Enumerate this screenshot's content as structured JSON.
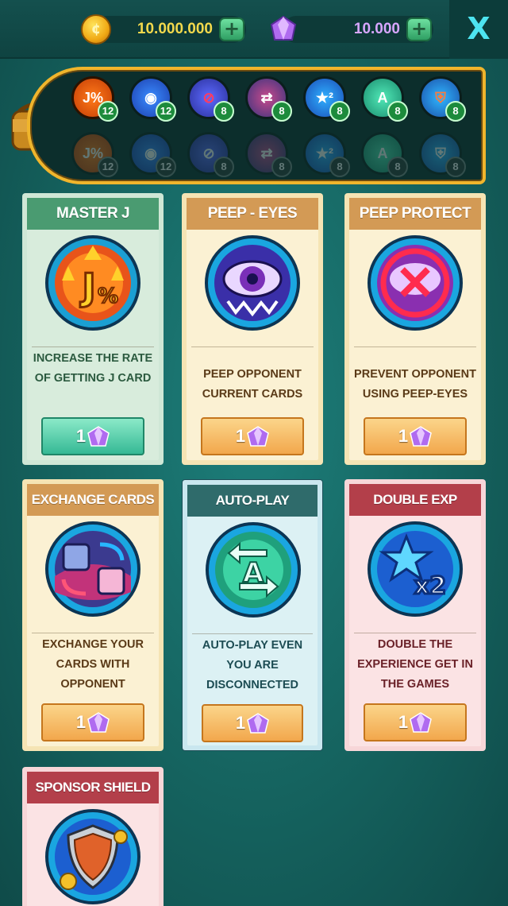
{
  "header": {
    "coins": "10.000.000",
    "gems": "10.000",
    "coin_icon": "coin-icon",
    "gem_icon": "gem-icon",
    "plus": "+",
    "close_label": "X"
  },
  "inventory": {
    "owned": [
      {
        "icon": "jackpot-icon",
        "count": "12"
      },
      {
        "icon": "eye-icon",
        "count": "12"
      },
      {
        "icon": "block-icon",
        "count": "8"
      },
      {
        "icon": "exchange-icon",
        "count": "8"
      },
      {
        "icon": "star-x2-icon",
        "count": "8"
      },
      {
        "icon": "autoplay-icon",
        "count": "8"
      },
      {
        "icon": "shield-icon",
        "count": "8"
      }
    ],
    "locked": [
      {
        "icon": "jackpot-icon",
        "count": "12"
      },
      {
        "icon": "eye-icon",
        "count": "12"
      },
      {
        "icon": "block-icon",
        "count": "8"
      },
      {
        "icon": "exchange-icon",
        "count": "8"
      },
      {
        "icon": "star-x2-icon",
        "count": "8"
      },
      {
        "icon": "autoplay-icon",
        "count": "8"
      },
      {
        "icon": "shield-icon",
        "count": "8"
      }
    ]
  },
  "cards": [
    {
      "title": "MASTER J",
      "desc": "INCREASE THE RATE OF GETTING J CARD",
      "price": "1"
    },
    {
      "title": "PEEP - EYES",
      "desc": "PEEP OPPONENT CURRENT CARDS",
      "price": "1"
    },
    {
      "title": "PEEP PROTECT",
      "desc": "PREVENT OPPONENT USING PEEP-EYES",
      "price": "1"
    },
    {
      "title": "EXCHANGE CARDS",
      "desc": "EXCHANGE YOUR CARDS WITH OPPONENT",
      "price": "1"
    },
    {
      "title": "AUTO-PLAY",
      "desc": "AUTO-PLAY EVEN YOU ARE DISCONNECTED",
      "price": "1"
    },
    {
      "title": "DOUBLE EXP",
      "desc": "DOUBLE THE EXPERIENCE GET IN THE GAMES",
      "price": "1"
    },
    {
      "title": "SPONSOR SHIELD",
      "desc": "",
      "price": ""
    }
  ],
  "colors": {
    "accent": "#f0b52c",
    "close": "#4de4f0",
    "background": "#15635f"
  }
}
